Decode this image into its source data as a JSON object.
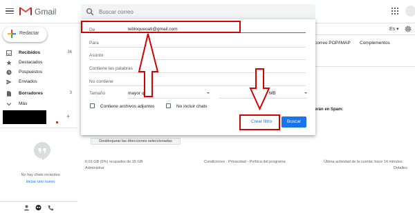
{
  "app": {
    "name": "Gmail"
  },
  "search": {
    "placeholder": "Buscar correo"
  },
  "sidebar": {
    "compose_label": "Redactar",
    "items": [
      {
        "label": "Recibidos",
        "count": "36",
        "bold": true,
        "icon": "inbox-icon"
      },
      {
        "label": "Destacados",
        "count": "",
        "bold": false,
        "icon": "star-icon"
      },
      {
        "label": "Pospuestos",
        "count": "",
        "bold": false,
        "icon": "clock-icon"
      },
      {
        "label": "Enviados",
        "count": "",
        "bold": false,
        "icon": "send-icon"
      },
      {
        "label": "Borradores",
        "count": "3",
        "bold": true,
        "icon": "draft-icon"
      },
      {
        "label": "Más",
        "count": "",
        "bold": false,
        "icon": "chevron-down-icon"
      }
    ],
    "add_label_symbol": "+",
    "chat": {
      "no_chats_text": "No hay chats recientes",
      "start_link": "Iniciar uno nuevo"
    }
  },
  "header": {
    "language": "Es",
    "settings_tabs": [
      "correo POP/IMAP",
      "Complementos"
    ]
  },
  "main": {
    "spam_text": "erán en Spam:",
    "unblock_button": "Desbloquear las direcciones seleccionadas",
    "storage": "0,01 GB (0%) ocupados de 15 GB",
    "manage": "Administrar",
    "footer_links": "Condiciones · Privacidad · Política del programa",
    "last_activity": "Última actividad de la cuenta: hace 14 minutos",
    "details": "Detalles"
  },
  "filter_dialog": {
    "from_label": "De",
    "from_value": "tebloqueoati@gmail.com",
    "to_label": "Para",
    "subject_label": "Asunto",
    "has_words_label": "Contiene las palabras",
    "doesnt_have_label": "No contiene",
    "size_label": "Tamaño",
    "size_operator": "mayor que",
    "size_value": "",
    "size_unit": "MB",
    "has_attachment_label": "Contiene archivos adjuntos",
    "no_chats_label": "No incluir chats",
    "create_filter_label": "Crear filtro",
    "search_label": "Buscar"
  },
  "colors": {
    "gmail_red": "#ea4335",
    "accent_blue": "#1a73e8",
    "annotation_red": "#d50000"
  }
}
